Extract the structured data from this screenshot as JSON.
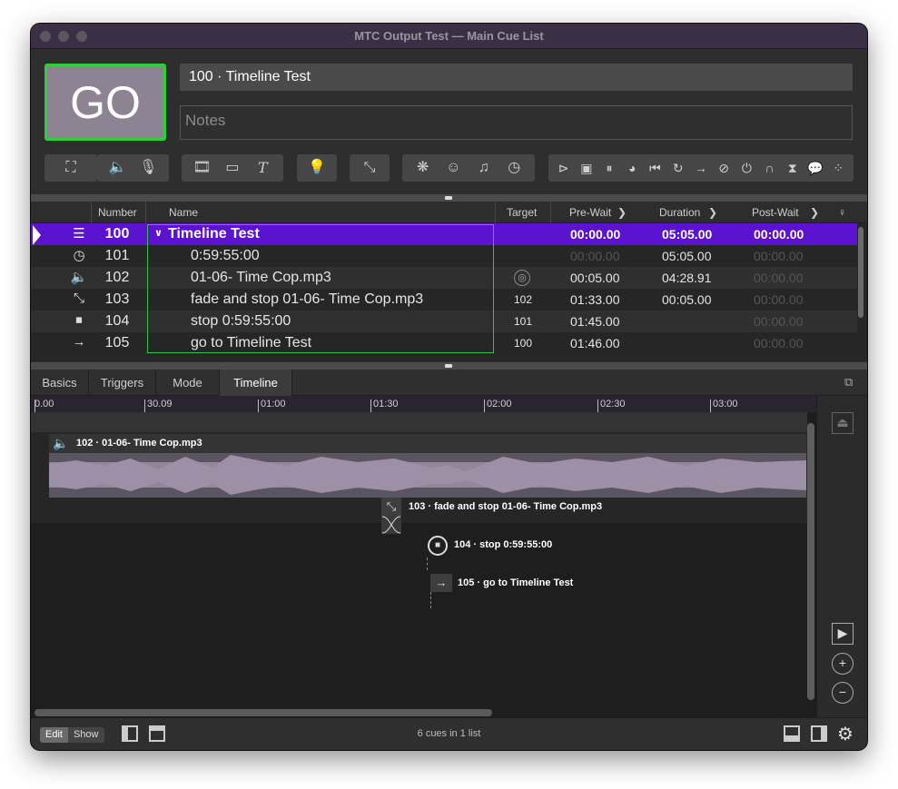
{
  "window": {
    "title": "MTC Output Test — Main Cue List"
  },
  "go": {
    "label": "GO"
  },
  "cue_name_field": {
    "value": "100 · Timeline Test"
  },
  "notes_field": {
    "placeholder": "Notes"
  },
  "toolbar": {
    "groups": [
      {
        "icons": [
          "fullscreen-icon"
        ]
      },
      {
        "icons": [
          "speaker-icon",
          "microphone-icon"
        ]
      },
      {
        "icons": [
          "film-icon",
          "camera-icon",
          "text-icon"
        ]
      },
      {
        "icons": [
          "light-bulb-icon"
        ]
      },
      {
        "icons": [
          "fade-icon"
        ]
      },
      {
        "icons": [
          "network-icon",
          "midi-icon",
          "music-note-icon",
          "clock-icon"
        ]
      },
      {
        "icons": [
          "play-icon",
          "stop-icon",
          "pause-icon",
          "load-icon",
          "reset-icon",
          "devamp-icon",
          "goto-icon",
          "target-icon",
          "arm-icon",
          "disarm-icon",
          "wait-icon",
          "memo-icon",
          "group-icon"
        ]
      }
    ]
  },
  "cue_table": {
    "columns": [
      "Number",
      "Name",
      "Target",
      "Pre-Wait",
      "Duration",
      "Post-Wait"
    ],
    "rows": [
      {
        "icon": "group-timeline-icon",
        "number": "100",
        "name": "Timeline Test",
        "target": "",
        "prewait": "00:00.00",
        "duration": "05:05.00",
        "postwait": "00:00.00"
      },
      {
        "icon": "timecode-clock-icon",
        "number": "101",
        "name": "0:59:55:00",
        "target": "",
        "prewait": "00:00.00",
        "duration": "05:05.00",
        "postwait": "00:00.00"
      },
      {
        "icon": "audio-speaker-icon",
        "number": "102",
        "name": "01-06- Time Cop.mp3",
        "target": "",
        "prewait": "00:05.00",
        "duration": "04:28.91",
        "postwait": "00:00.00"
      },
      {
        "icon": "fade-icon",
        "number": "103",
        "name": "fade and stop 01-06- Time Cop.mp3",
        "target": "102",
        "prewait": "01:33.00",
        "duration": "00:05.00",
        "postwait": "00:00.00"
      },
      {
        "icon": "stop-circle-icon",
        "number": "104",
        "name": "stop 0:59:55:00",
        "target": "101",
        "prewait": "01:45.00",
        "duration": "",
        "postwait": "00:00.00"
      },
      {
        "icon": "goto-arrow-icon",
        "number": "105",
        "name": "go to Timeline Test",
        "target": "100",
        "prewait": "01:46.00",
        "duration": "",
        "postwait": "00:00.00"
      }
    ]
  },
  "tabs": [
    "Basics",
    "Triggers",
    "Mode",
    "Timeline"
  ],
  "active_tab": "Timeline",
  "timeline": {
    "ruler": [
      "0.00",
      "30.09",
      "01:00",
      "01:30",
      "02:00",
      "02:30",
      "03:00"
    ],
    "blocks": [
      {
        "label": "102 · 01-06- Time Cop.mp3"
      },
      {
        "label": "103 · fade and stop 01-06- Time Cop.mp3"
      },
      {
        "label": "104 · stop 0:59:55:00"
      },
      {
        "label": "105 · go to Timeline Test"
      }
    ]
  },
  "statusbar": {
    "mode_edit": "Edit",
    "mode_show": "Show",
    "text": "6 cues in 1 list"
  },
  "colors": {
    "accent": "#5b13cf",
    "go_border": "#2ed03a",
    "group_outline": "#2ec24a",
    "waveform": "#9d8fa5"
  }
}
